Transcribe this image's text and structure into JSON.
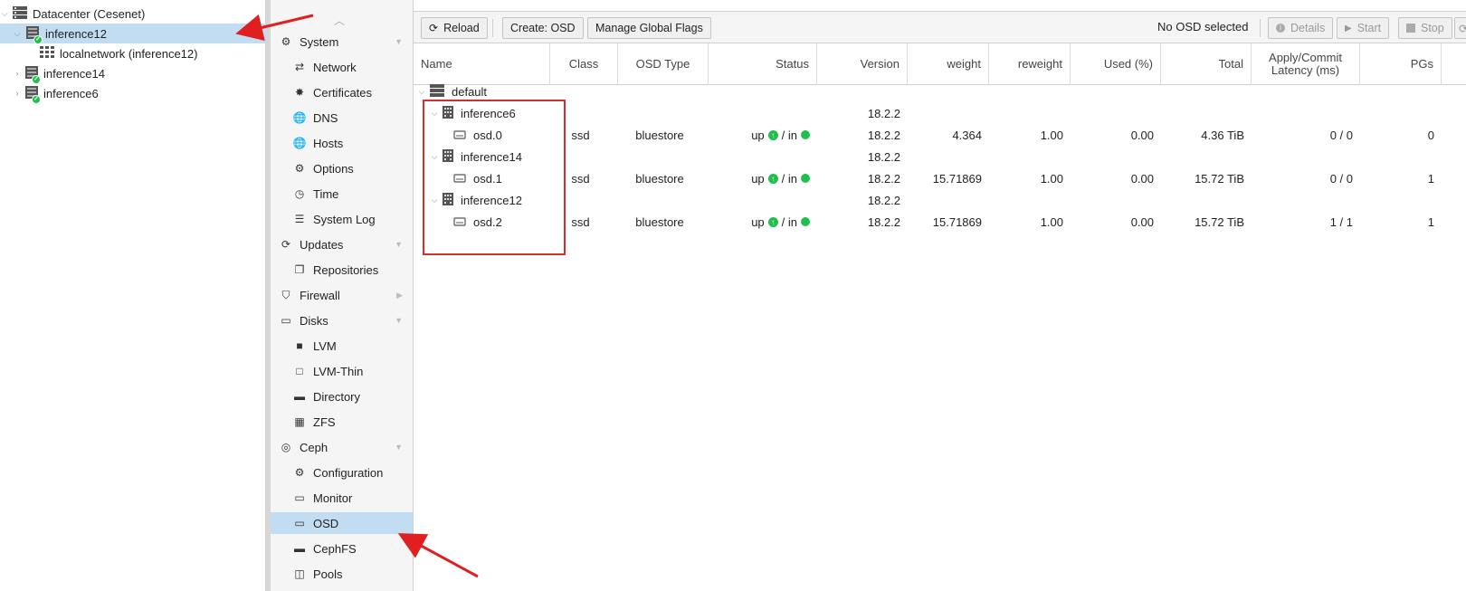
{
  "tree": {
    "datacenter": "Datacenter (Cesenet)",
    "nodes": [
      {
        "label": "inference12",
        "selected": true
      },
      {
        "label": "localnetwork (inference12)"
      },
      {
        "label": "inference14"
      },
      {
        "label": "inference6"
      }
    ]
  },
  "nav": {
    "items": [
      {
        "label": "System",
        "icon": "gears-icon",
        "top": true
      },
      {
        "label": "Network",
        "icon": "network-icon"
      },
      {
        "label": "Certificates",
        "icon": "certificate-icon"
      },
      {
        "label": "DNS",
        "icon": "globe-icon"
      },
      {
        "label": "Hosts",
        "icon": "globe-icon"
      },
      {
        "label": "Options",
        "icon": "gear-icon"
      },
      {
        "label": "Time",
        "icon": "clock-icon"
      },
      {
        "label": "System Log",
        "icon": "list-icon"
      },
      {
        "label": "Updates",
        "icon": "refresh-icon",
        "top": true
      },
      {
        "label": "Repositories",
        "icon": "files-icon"
      },
      {
        "label": "Firewall",
        "icon": "shield-icon",
        "top": true
      },
      {
        "label": "Disks",
        "icon": "hdd-icon",
        "top": true
      },
      {
        "label": "LVM",
        "icon": "square-icon"
      },
      {
        "label": "LVM-Thin",
        "icon": "square-outline-icon"
      },
      {
        "label": "Directory",
        "icon": "folder-icon"
      },
      {
        "label": "ZFS",
        "icon": "grid-icon"
      },
      {
        "label": "Ceph",
        "icon": "ceph-icon",
        "top": true
      },
      {
        "label": "Configuration",
        "icon": "gear-icon"
      },
      {
        "label": "Monitor",
        "icon": "monitor-icon"
      },
      {
        "label": "OSD",
        "icon": "hdd-icon",
        "selected": true
      },
      {
        "label": "CephFS",
        "icon": "folder-icon"
      },
      {
        "label": "Pools",
        "icon": "pools-icon"
      }
    ]
  },
  "toolbar": {
    "reload": "Reload",
    "create_osd": "Create: OSD",
    "manage_flags": "Manage Global Flags",
    "no_osd_selected": "No OSD selected",
    "details": "Details",
    "start": "Start",
    "stop": "Stop"
  },
  "columns": {
    "name": "Name",
    "class": "Class",
    "osd_type": "OSD Type",
    "status": "Status",
    "version": "Version",
    "weight": "weight",
    "reweight": "reweight",
    "used": "Used (%)",
    "total": "Total",
    "latency_1": "Apply/Commit",
    "latency_2": "Latency (ms)",
    "pgs": "PGs"
  },
  "rows": [
    {
      "type": "root",
      "name": "default"
    },
    {
      "type": "host",
      "name": "inference6",
      "version": "18.2.2"
    },
    {
      "type": "osd",
      "name": "osd.0",
      "class": "ssd",
      "osd_type": "bluestore",
      "status_up": "up",
      "status_in": "/ in",
      "version": "18.2.2",
      "weight": "4.364",
      "reweight": "1.00",
      "used": "0.00",
      "total": "4.36 TiB",
      "latency": "0 / 0",
      "pgs": "0"
    },
    {
      "type": "host",
      "name": "inference14",
      "version": "18.2.2"
    },
    {
      "type": "osd",
      "name": "osd.1",
      "class": "ssd",
      "osd_type": "bluestore",
      "status_up": "up",
      "status_in": "/ in",
      "version": "18.2.2",
      "weight": "15.71869",
      "reweight": "1.00",
      "used": "0.00",
      "total": "15.72 TiB",
      "latency": "0 / 0",
      "pgs": "1"
    },
    {
      "type": "host",
      "name": "inference12",
      "version": "18.2.2"
    },
    {
      "type": "osd",
      "name": "osd.2",
      "class": "ssd",
      "osd_type": "bluestore",
      "status_up": "up",
      "status_in": "/ in",
      "version": "18.2.2",
      "weight": "15.71869",
      "reweight": "1.00",
      "used": "0.00",
      "total": "15.72 TiB",
      "latency": "1 / 1",
      "pgs": "1"
    }
  ],
  "colors": {
    "selection": "#c2ddf2",
    "status_green": "#21bf4b",
    "annotation_red": "#d32f2f"
  }
}
